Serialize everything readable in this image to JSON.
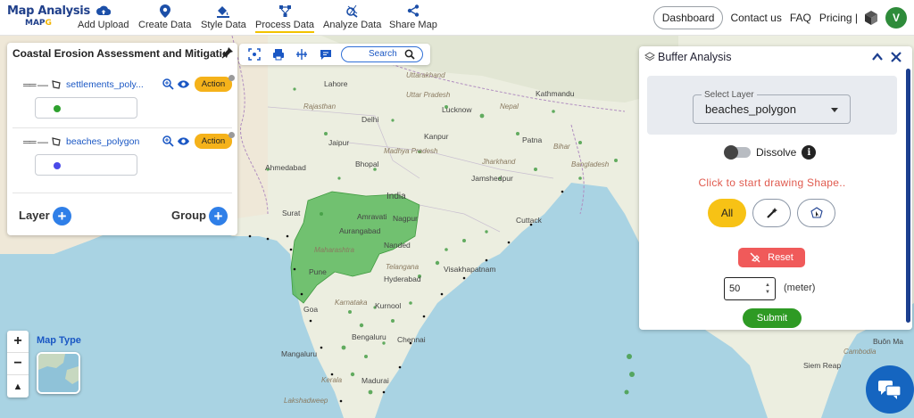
{
  "header": {
    "logo_title": "Map Analysis",
    "logo_sub_a": "MAP",
    "logo_sub_b": "ᴄ",
    "nav": [
      {
        "label": "Add Upload",
        "icon": "cloud-upload-icon"
      },
      {
        "label": "Create Data",
        "icon": "map-pin-icon"
      },
      {
        "label": "Style Data",
        "icon": "paint-bucket-icon"
      },
      {
        "label": "Process Data",
        "icon": "process-nodes-icon",
        "active": true
      },
      {
        "label": "Analyze Data",
        "icon": "analyze-icon"
      },
      {
        "label": "Share Map",
        "icon": "share-icon"
      }
    ],
    "dashboard": "Dashboard",
    "contact": "Contact us",
    "faq": "FAQ",
    "pricing": "Pricing |",
    "avatar_letter": "V"
  },
  "layer_panel": {
    "title": "Coastal Erosion Assessment and Mitigation",
    "layers": [
      {
        "name": "settlements_poly...",
        "action": "Action",
        "color": "#2ea12e"
      },
      {
        "name": "beaches_polygon",
        "action": "Action",
        "color": "#4a4ae8"
      }
    ],
    "layer_label": "Layer",
    "group_label": "Group"
  },
  "toolbar": {
    "search_label": "Search"
  },
  "buffer": {
    "title": "Buffer Analysis",
    "select_label": "Select Layer",
    "select_value": "beaches_polygon",
    "dissolve_label": "Dissolve",
    "info": "i",
    "hint": "Click to start drawing Shape..",
    "all_label": "All",
    "reset_label": "Reset",
    "distance_value": "50",
    "unit_label": "(meter)",
    "submit_label": "Submit"
  },
  "map_controls": {
    "zoom_in": "+",
    "zoom_out": "−",
    "compass": "▲",
    "map_type_label": "Map Type"
  },
  "map_labels": {
    "cities": [
      "Lahore",
      "Delhi",
      "Jaipur",
      "Lucknow",
      "Patna",
      "Kanpur",
      "Rajasthan",
      "Uttar Pradesh",
      "Bihar",
      "Madhya Pradesh",
      "Ahmedabad",
      "Bhopal",
      "Jharkhand",
      "Jamshedpur",
      "Surat",
      "India",
      "Amravati",
      "Maharashtra",
      "Cuttack",
      "Nagpur",
      "Aurangabad",
      "Nanded",
      "Telangana",
      "Hyderabad",
      "Visakhapatnam",
      "Pune",
      "Karnataka",
      "Kurnool",
      "Goa",
      "Bengaluru",
      "Chennai",
      "Mangaluru",
      "Kerala",
      "Madurai",
      "Lakshadweep",
      "Kathmandu",
      "Nepal",
      "Uttarakhand",
      "Bangladesh",
      "Buôn Ma",
      "Cambodia",
      "Siem Reap"
    ]
  }
}
